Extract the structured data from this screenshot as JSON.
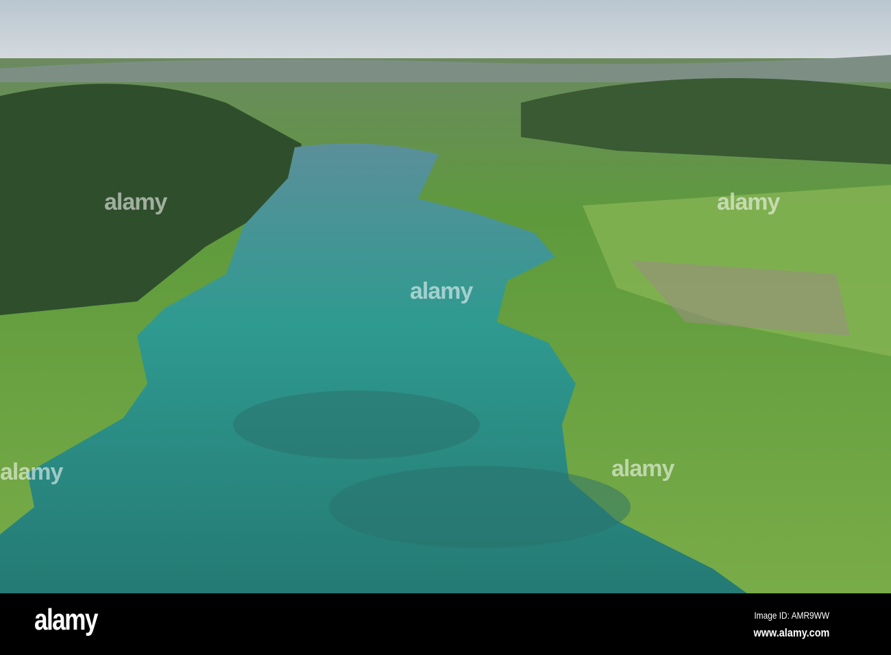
{
  "photo": {
    "subject": "aerial lake view"
  },
  "watermark": {
    "text": "alamy"
  },
  "footer": {
    "logo": "alamy",
    "image_id": "Image ID: AMR9WW",
    "website": "www.alamy.com"
  },
  "colors": {
    "lake": "#2f8f88",
    "land": "#5f9a3a",
    "forest": "#2e4d2a",
    "sky": "#c9d3da"
  }
}
